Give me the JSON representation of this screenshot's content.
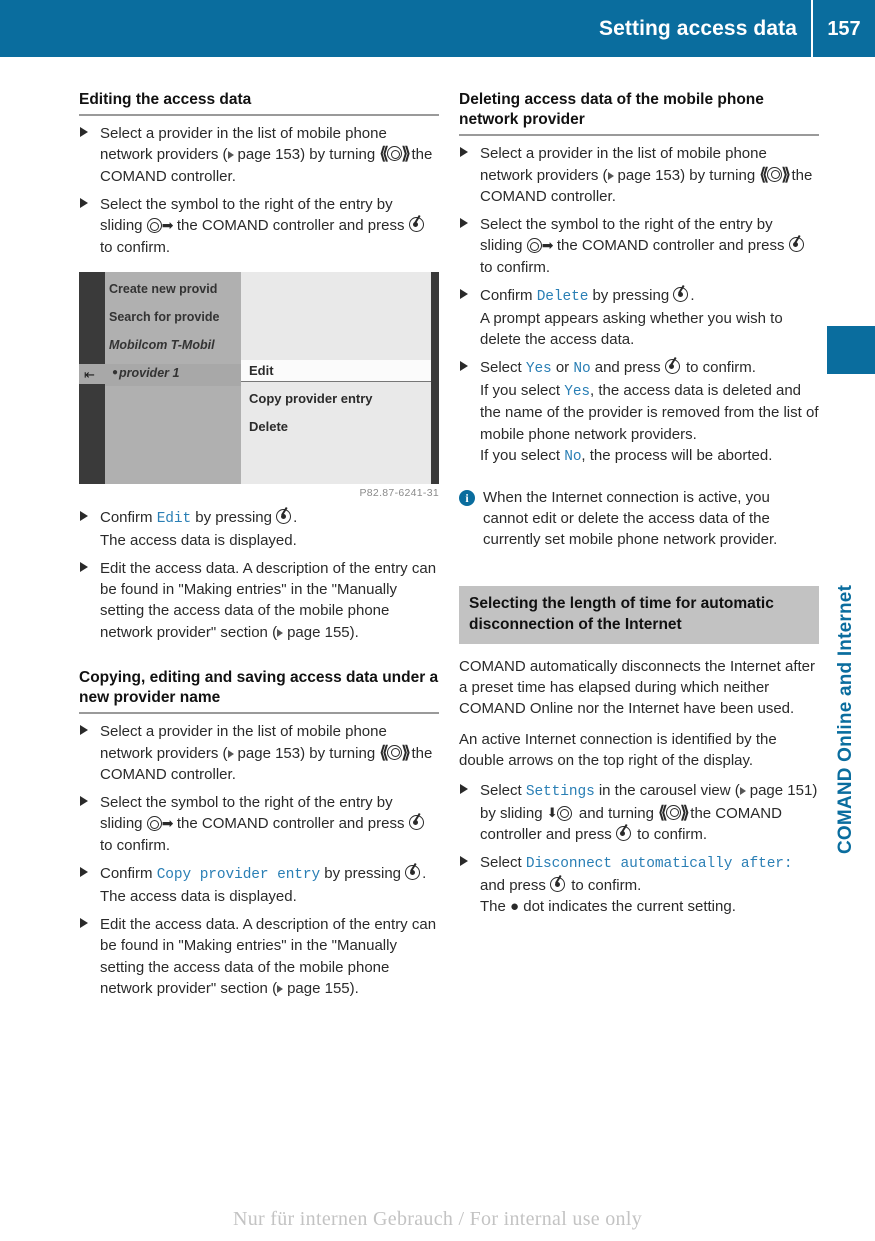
{
  "header": {
    "title": "Setting access data",
    "page_number": "157",
    "accent_color": "#0a6d9e"
  },
  "side_tab": {
    "label": "COMAND Online and Internet"
  },
  "footer": {
    "watermark": "Nur für internen Gebrauch / For internal use only"
  },
  "left_column": {
    "heading1": "Editing the access data",
    "bullets1": [
      {
        "pre": "Select a provider in the list of mobile phone network providers (",
        "ref": "page 153",
        "mid": ") by turning ",
        "glyph": "turn-controller-icon",
        "post": " the COMAND controller."
      },
      {
        "pre": "Select the symbol to the right of the entry by sliding ",
        "glyph": "slide-right-controller-icon",
        "mid": " the COMAND controller and press ",
        "glyph2": "press-controller-icon",
        "post": " to confirm."
      }
    ],
    "screenshot": {
      "list_items": [
        "Create new provid",
        "Search for provide",
        "Mobilcom T-Mobil",
        "provider 1"
      ],
      "menu_items": [
        "Edit",
        "Copy provider entry",
        "Delete"
      ],
      "selected_menu_item": "Edit",
      "caption": "P82.87-6241-31"
    },
    "bullets2": [
      {
        "pre": "Confirm ",
        "token": "Edit",
        "mid": " by pressing ",
        "glyph": "press-controller-icon",
        "post": ".",
        "sub": "The access data is displayed."
      },
      {
        "pre": "Edit the access data. A description of the entry can be found in \"Making entries\" in the \"Manually setting the access data of the mobile phone network provider\" section (",
        "ref": "page 155",
        "post": ")."
      }
    ],
    "heading2": "Copying, editing and saving access data under a new provider name",
    "bullets3": [
      {
        "pre": "Select a provider in the list of mobile phone network providers (",
        "ref": "page 153",
        "mid": ") by turning ",
        "glyph": "turn-controller-icon",
        "post": " the COMAND controller."
      },
      {
        "pre": "Select the symbol to the right of the entry by sliding ",
        "glyph": "slide-right-controller-icon",
        "mid": " the COMAND controller and press ",
        "glyph2": "press-controller-icon",
        "post": " to confirm."
      },
      {
        "pre": "Confirm ",
        "token": "Copy provider entry",
        "mid": " by pressing ",
        "glyph": "press-controller-icon",
        "post": ".",
        "sub": "The access data is displayed."
      },
      {
        "pre": "Edit the access data. A description of the entry can be found in \"Making entries\" in the \"Manually setting the access data of the mobile phone network provider\" section (",
        "ref": "page 155",
        "post": ")."
      }
    ]
  },
  "right_column": {
    "heading1": "Deleting access data of the mobile phone network provider",
    "bullets1": [
      {
        "pre": "Select a provider in the list of mobile phone network providers (",
        "ref": "page 153",
        "mid": ") by turning ",
        "glyph": "turn-controller-icon",
        "post": " the COMAND controller."
      },
      {
        "pre": "Select the symbol to the right of the entry by sliding ",
        "glyph": "slide-right-controller-icon",
        "mid": " the COMAND controller and press ",
        "glyph2": "press-controller-icon",
        "post": " to confirm."
      },
      {
        "pre": "Confirm ",
        "token": "Delete",
        "mid": " by pressing ",
        "glyph": "press-controller-icon",
        "post": ".",
        "sub": "A prompt appears asking whether you wish to delete the access data."
      },
      {
        "pre": "Select ",
        "token": "Yes",
        "mid": " or ",
        "token2": "No",
        "mid2": " and press ",
        "glyph": "press-controller-icon",
        "post": " to confirm.",
        "sub_a_pre": "If you select ",
        "sub_a_token": "Yes",
        "sub_a_post": ", the access data is deleted and the name of the provider is removed from the list of mobile phone network providers.",
        "sub_b_pre": "If you select ",
        "sub_b_token": "No",
        "sub_b_post": ", the process will be aborted."
      }
    ],
    "note": {
      "icon": "info-icon",
      "text": "When the Internet connection is active, you cannot edit or delete the access data of the currently set mobile phone network provider."
    },
    "gray_heading": "Selecting the length of time for automatic disconnection of the Internet",
    "paragraphs": [
      "COMAND automatically disconnects the Internet after a preset time has elapsed during which neither COMAND Online nor the Internet have been used.",
      "An active Internet connection is identified by the double arrows on the top right of the display."
    ],
    "bullets2": [
      {
        "pre": "Select ",
        "token": "Settings",
        "mid": " in the carousel view (",
        "ref": "page 151",
        "mid2": ") by sliding ",
        "glyph": "slide-down-controller-icon",
        "mid3": " and turning ",
        "glyph2": "turn-controller-icon",
        "mid4": " the COMAND controller and press ",
        "glyph3": "press-controller-icon",
        "post": " to confirm."
      },
      {
        "pre": "Select ",
        "token": "Disconnect automatically after:",
        "mid": " and press ",
        "glyph": "press-controller-icon",
        "post": " to confirm.",
        "sub_pre": "The ",
        "sub_dot": "●",
        "sub_post": " dot indicates the current setting."
      }
    ]
  }
}
